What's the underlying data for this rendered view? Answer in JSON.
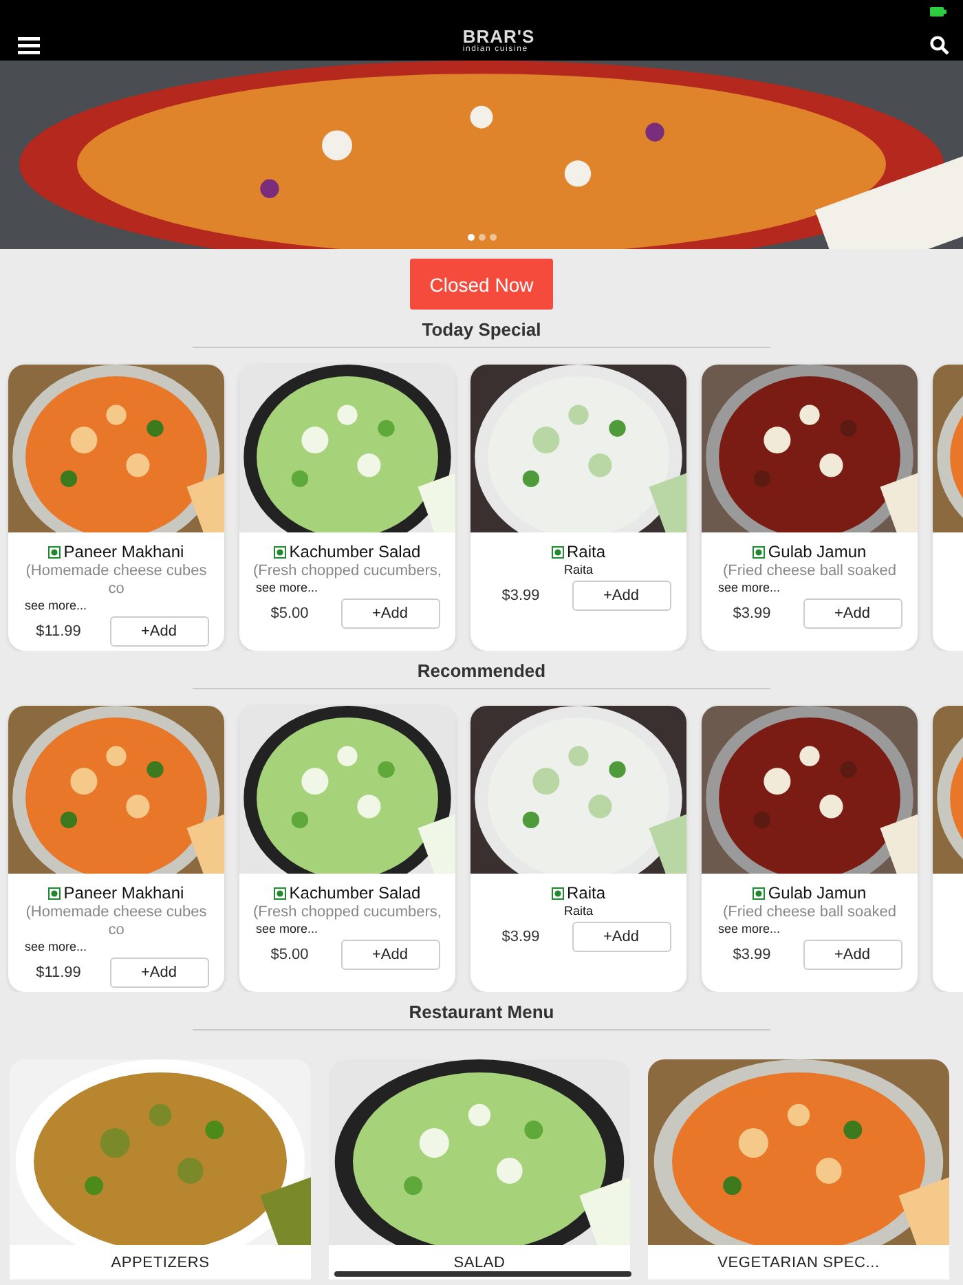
{
  "header": {
    "logo_title": "BRAR'S",
    "logo_subtitle": "indian cuisine"
  },
  "banner": {
    "dots": [
      {
        "selected": true
      },
      {
        "selected": false
      },
      {
        "selected": false
      }
    ]
  },
  "status_button": "Closed Now",
  "sections": [
    {
      "title": "Today Special",
      "items": [
        {
          "name": "Paneer Makhani",
          "veg": true,
          "description": "(Homemade cheese cubes co",
          "see_more": "see more...",
          "price": "$11.99",
          "button": "+Add"
        },
        {
          "name": "Kachumber Salad",
          "veg": true,
          "description": "(Fresh chopped cucumbers,",
          "see_more": "see more...",
          "price": "$5.00",
          "button": "+Add"
        },
        {
          "name": "Raita",
          "veg": true,
          "subtitle": "Raita",
          "price": "$3.99",
          "button": "+Add"
        },
        {
          "name": "Gulab Jamun",
          "veg": true,
          "description": "(Fried cheese ball soaked",
          "see_more": "see more...",
          "price": "$3.99",
          "button": "+Add"
        }
      ]
    },
    {
      "title": "Recommended",
      "items": [
        {
          "name": "Paneer Makhani",
          "veg": true,
          "description": "(Homemade cheese cubes co",
          "see_more": "see more...",
          "price": "$11.99",
          "button": "+Add"
        },
        {
          "name": "Kachumber Salad",
          "veg": true,
          "description": "(Fresh chopped cucumbers,",
          "see_more": "see more...",
          "price": "$5.00",
          "button": "+Add"
        },
        {
          "name": "Raita",
          "veg": true,
          "subtitle": "Raita",
          "price": "$3.99",
          "button": "+Add"
        },
        {
          "name": "Gulab Jamun",
          "veg": true,
          "description": "(Fried cheese ball soaked",
          "see_more": "see more...",
          "price": "$3.99",
          "button": "+Add"
        }
      ]
    }
  ],
  "menu": {
    "title": "Restaurant Menu",
    "categories": [
      {
        "label": "APPETIZERS"
      },
      {
        "label": "SALAD"
      },
      {
        "label": "VEGETARIAN SPEC..."
      }
    ]
  }
}
